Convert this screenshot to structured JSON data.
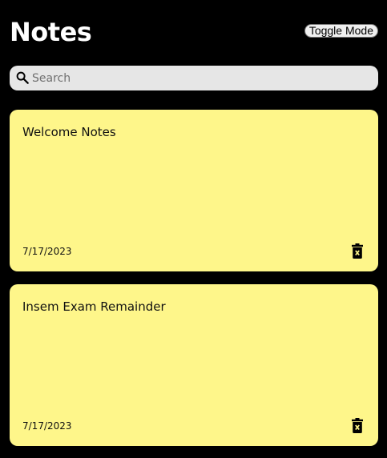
{
  "header": {
    "title": "Notes",
    "toggle_label": "Toggle Mode"
  },
  "search": {
    "placeholder": "Search",
    "value": "",
    "icon": "search-icon"
  },
  "notes": [
    {
      "text": "Welcome Notes",
      "date": "7/17/2023",
      "delete_icon": "trash-icon"
    },
    {
      "text": "Insem Exam Remainder",
      "date": "7/17/2023",
      "delete_icon": "trash-icon"
    }
  ],
  "colors": {
    "background": "#000000",
    "note_background": "#fef68a",
    "search_background": "#e6e6e6"
  }
}
